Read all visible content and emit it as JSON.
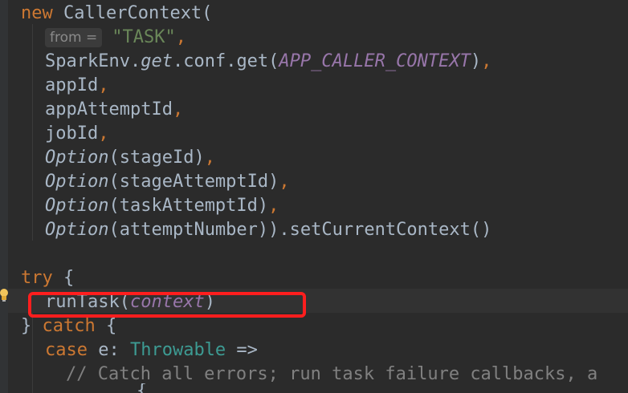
{
  "code": {
    "l1": {
      "kw_new": "new",
      "text": " CallerContext("
    },
    "l2": {
      "hint": "from =",
      "str": "\"TASK\"",
      "comma": ","
    },
    "l3": {
      "text_a": "SparkEnv.",
      "get": "get",
      "text_b": ".conf.get(",
      "const": "APP_CALLER_CONTEXT",
      "close": ")",
      "comma": ","
    },
    "l4": {
      "text": "appId",
      "comma": ","
    },
    "l5": {
      "text": "appAttemptId",
      "comma": ","
    },
    "l6": {
      "text": "jobId",
      "comma": ","
    },
    "l7": {
      "fn": "Option",
      "text": "(stageId)",
      "comma": ","
    },
    "l8": {
      "fn": "Option",
      "text": "(stageAttemptId)",
      "comma": ","
    },
    "l9": {
      "fn": "Option",
      "text": "(taskAttemptId)",
      "comma": ","
    },
    "l10": {
      "fn": "Option",
      "text": "(attemptNumber)).setCurrentContext()"
    },
    "l12": {
      "kw_try": "try",
      "text": " {"
    },
    "l13": {
      "fn": "runTask(",
      "arg": "context",
      "close": ")"
    },
    "l14": {
      "text": "} ",
      "kw_catch": "catch",
      "brace": " {"
    },
    "l15": {
      "kw_case": "case",
      "text_a": " e: ",
      "type": "Throwable",
      "arrow": " =>"
    },
    "l16": {
      "comment": "// Catch all errors; run task failure callbacks, a"
    },
    "l17": {
      "text": "{"
    }
  },
  "colors": {
    "background": "#2b2b2b",
    "keyword": "#cc7832",
    "string": "#6a8759",
    "constant": "#9876aa",
    "type": "#3d9b93",
    "comment": "#808080",
    "highlight_box": "#ff1e1e"
  },
  "icons": {
    "intention": "lightbulb-icon"
  }
}
